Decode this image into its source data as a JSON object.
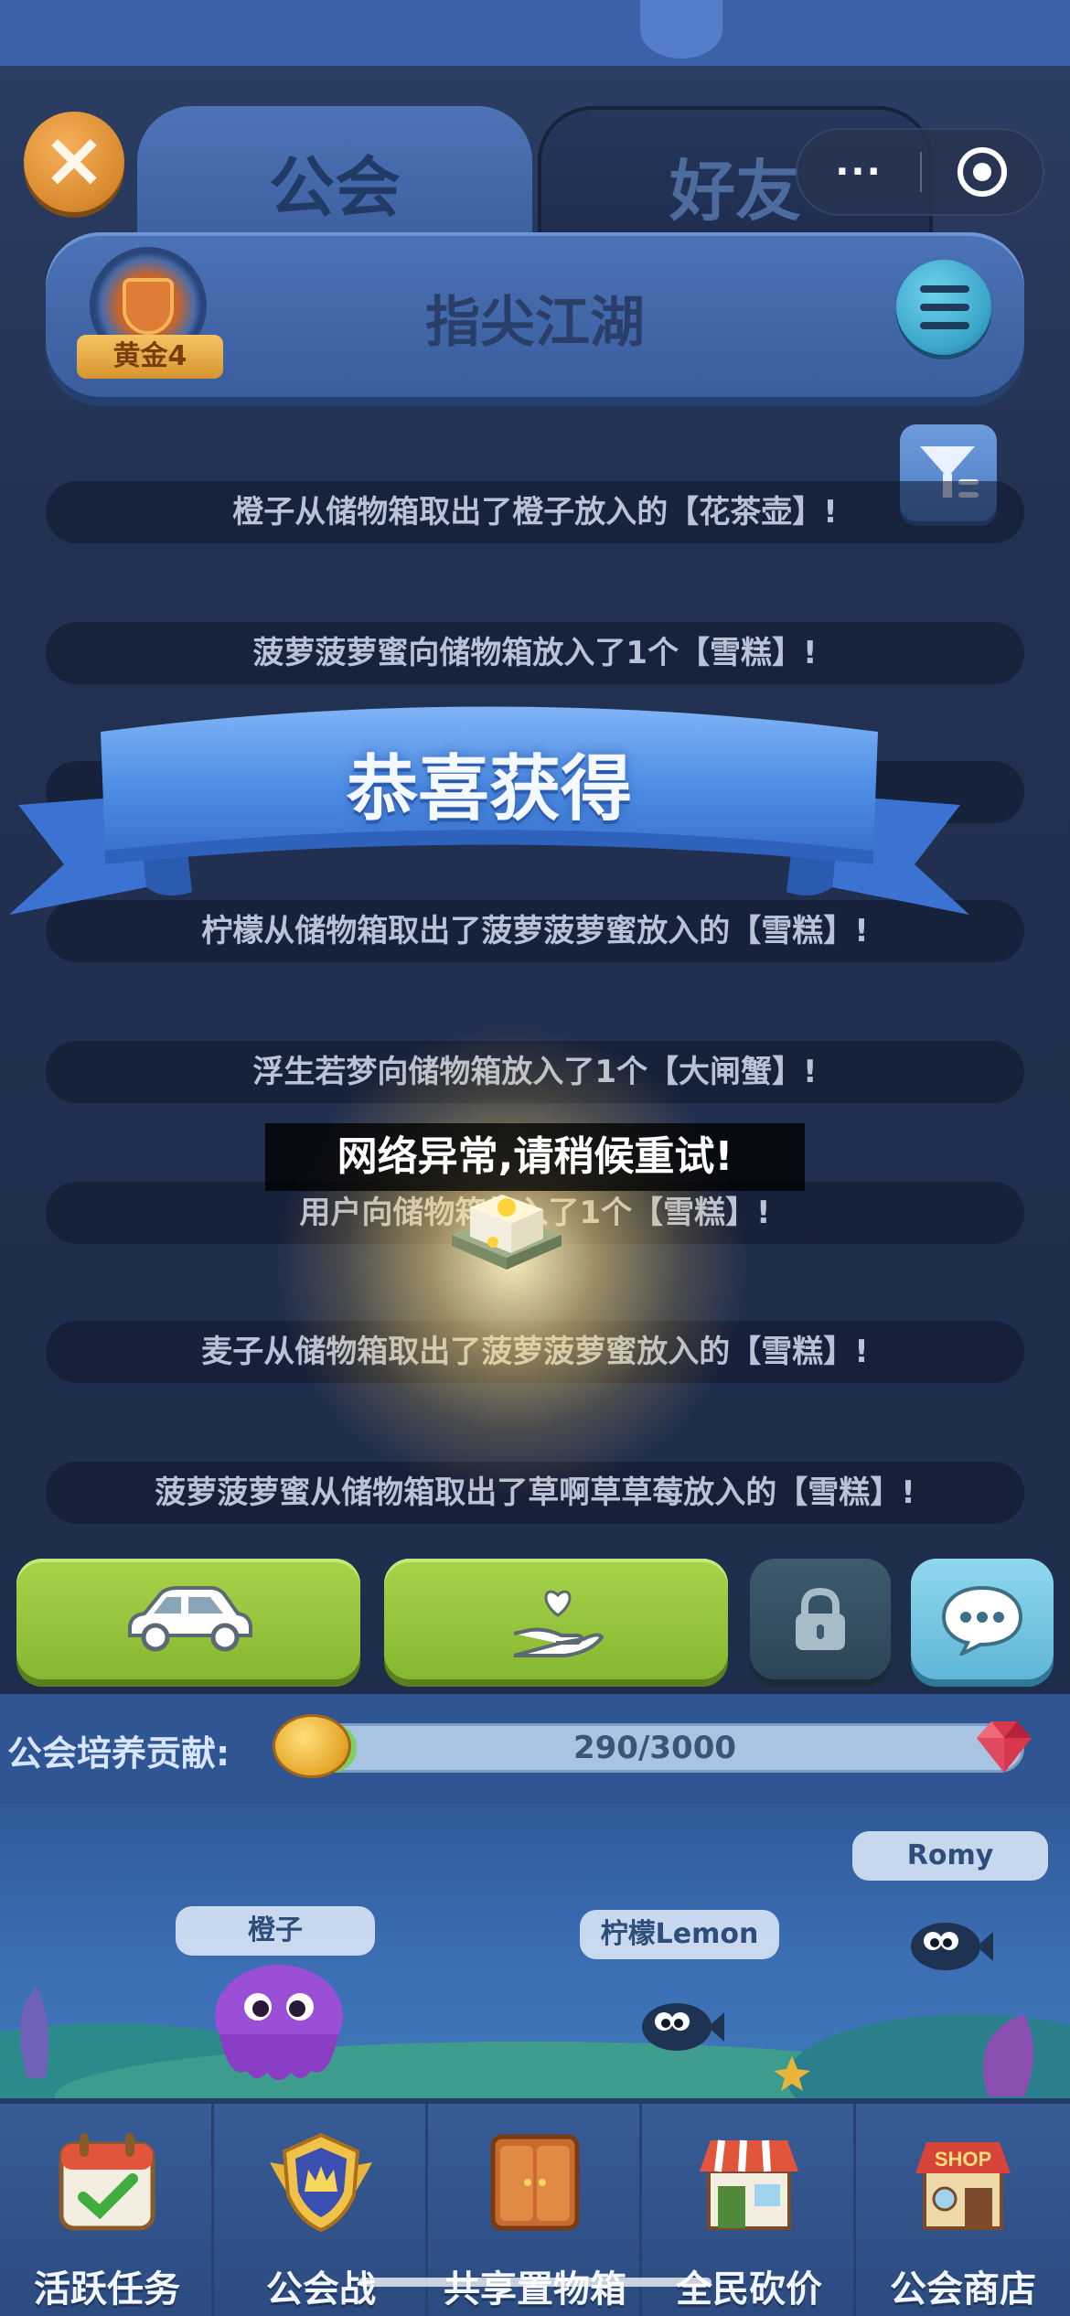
{
  "tabs": [
    {
      "label": "公会"
    },
    {
      "label": "好友"
    }
  ],
  "capsule": {
    "more_icon": "···"
  },
  "guild": {
    "name": "指尖江湖",
    "rank": "黄金4"
  },
  "logs": [
    "橙子从储物箱取出了橙子放入的【花茶壶】!",
    "菠萝菠萝蜜向储物箱放入了1个【雪糕】!",
    "",
    "柠檬从储物箱取出了菠萝菠萝蜜放入的【雪糕】!",
    "浮生若梦向储物箱放入了1个【大闸蟹】!",
    "用户向储物箱放入了1个【雪糕】!",
    "麦子从储物箱取出了菠萝菠萝蜜放入的【雪糕】!",
    "菠萝菠萝蜜从储物箱取出了草啊草草莓放入的【雪糕】!"
  ],
  "reward": {
    "banner_title": "恭喜获得",
    "item_icon": "cake-item"
  },
  "toast": "网络异常,请稍候重试!",
  "actions": {
    "icons": [
      "car-icon",
      "heart-hand-icon",
      "lock-icon",
      "chat-icon"
    ]
  },
  "contribution": {
    "label": "公会培养贡献:",
    "text": "290/3000",
    "current": 290,
    "max": 3000
  },
  "members": [
    {
      "name": "橙子"
    },
    {
      "name": "柠檬Lemon"
    },
    {
      "name": "Romy"
    }
  ],
  "nav": [
    {
      "label": "活跃任务",
      "icon": "calendar-check-icon"
    },
    {
      "label": "公会战",
      "icon": "crown-shield-icon"
    },
    {
      "label": "共享置物箱",
      "icon": "wardrobe-icon"
    },
    {
      "label": "全民砍价",
      "icon": "store-icon"
    },
    {
      "label": "公会商店",
      "icon": "shop-icon"
    }
  ],
  "colors": {
    "panel": "#233253",
    "tab_active": "#4e74b8",
    "action_green": "#9bca3f",
    "progress": "#7bd163"
  }
}
